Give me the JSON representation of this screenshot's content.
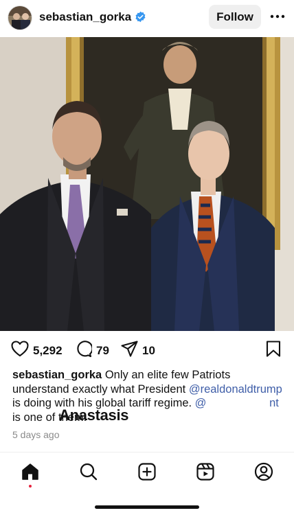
{
  "post": {
    "username": "sebastian_gorka",
    "follow_label": "Follow",
    "likes": "5,292",
    "comments": "79",
    "shares": "10",
    "caption_user": "sebastian_gorka",
    "caption_part1": " Only an elite few Patriots understand exactly what President ",
    "caption_mention1": "@realdonaldtrump",
    "caption_part2": " is doing with his global tariff regime. ",
    "caption_mention2": "@                    nt",
    "caption_part3": " is one of them.",
    "overlay_text": "Anastasis",
    "time_ago": "5 days ago"
  },
  "icons": {
    "verified": "verified-badge-icon",
    "more": "more-horizontal-icon",
    "like": "heart-icon",
    "comment": "comment-bubble-icon",
    "share": "paper-plane-icon",
    "save": "bookmark-icon",
    "nav": [
      "home-icon",
      "search-icon",
      "create-plus-icon",
      "reels-icon",
      "profile-icon"
    ]
  },
  "colors": {
    "mention": "#3f5ea8",
    "verified": "#3797f0",
    "follow_bg": "#efefef",
    "notification_dot": "#e4233d"
  }
}
